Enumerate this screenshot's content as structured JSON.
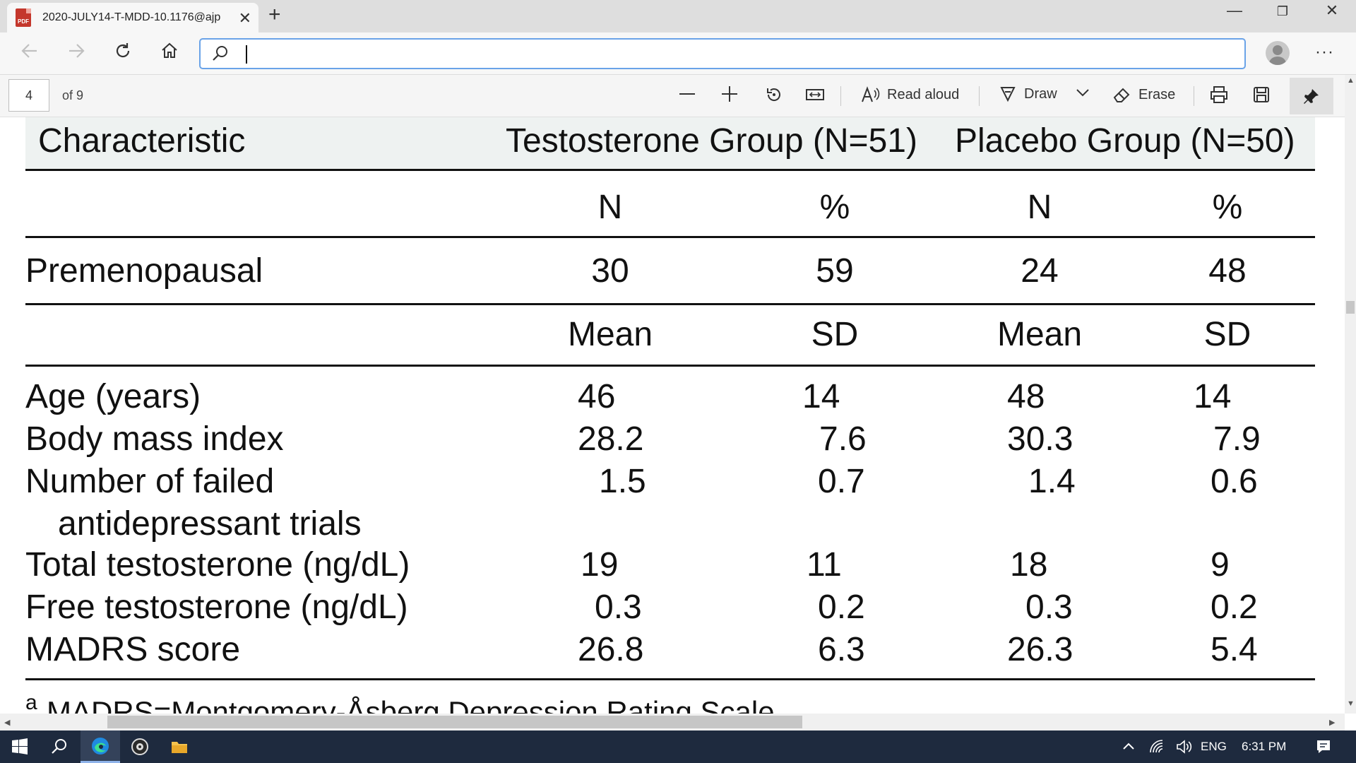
{
  "browser": {
    "tab_title": "2020-JULY14-T-MDD-10.1176@ajp",
    "tab_badge": "PDF",
    "address_value": "",
    "window_controls": [
      "minimize",
      "restore",
      "close"
    ]
  },
  "pdf_toolbar": {
    "page_number": "4",
    "page_total": "of 9",
    "read_aloud_label": "Read aloud",
    "draw_label": "Draw",
    "erase_label": "Erase"
  },
  "table": {
    "header": {
      "characteristic": "Characteristic",
      "group1": "Testosterone Group (N=51)",
      "group2": "Placebo Group (N=50)"
    },
    "subheader1": [
      "N",
      "%",
      "N",
      "%"
    ],
    "premenopausal": {
      "label": "Premenopausal",
      "values": [
        "30",
        "59",
        "24",
        "48"
      ]
    },
    "subheader2": [
      "Mean",
      "SD",
      "Mean",
      "SD"
    ],
    "rows": [
      {
        "label": "Age (years)",
        "label2": "",
        "values": [
          "46",
          "14",
          "48",
          "14"
        ]
      },
      {
        "label": "Body mass index",
        "label2": "",
        "values": [
          "28.2",
          "7.6",
          "30.3",
          "7.9"
        ]
      },
      {
        "label": "Number of failed",
        "label2": "antidepressant trials",
        "values": [
          "1.5",
          "0.7",
          "1.4",
          "0.6"
        ]
      },
      {
        "label": "Total testosterone (ng/dL)",
        "label2": "",
        "values": [
          "19",
          "11",
          "18",
          "9"
        ]
      },
      {
        "label": "Free testosterone (ng/dL)",
        "label2": "",
        "values": [
          "0.3",
          "0.2",
          "0.3",
          "0.2"
        ]
      },
      {
        "label": "MADRS score",
        "label2": "",
        "values": [
          "26.8",
          "6.3",
          "26.3",
          "5.4"
        ]
      }
    ],
    "footnote_marker": "a",
    "footnote": "MADRS=Montgomery-Åsberg Depression Rating Scale."
  },
  "taskbar": {
    "language": "ENG",
    "time": "6:31 PM"
  },
  "icons": {
    "back": "arrow-left-icon",
    "forward": "arrow-right-icon",
    "refresh": "refresh-icon",
    "home": "home-icon",
    "search": "search-icon"
  },
  "colors": {
    "accent": "#6aa3e8",
    "header_band": "#eef2f1",
    "taskbar": "#1e2a3e"
  }
}
